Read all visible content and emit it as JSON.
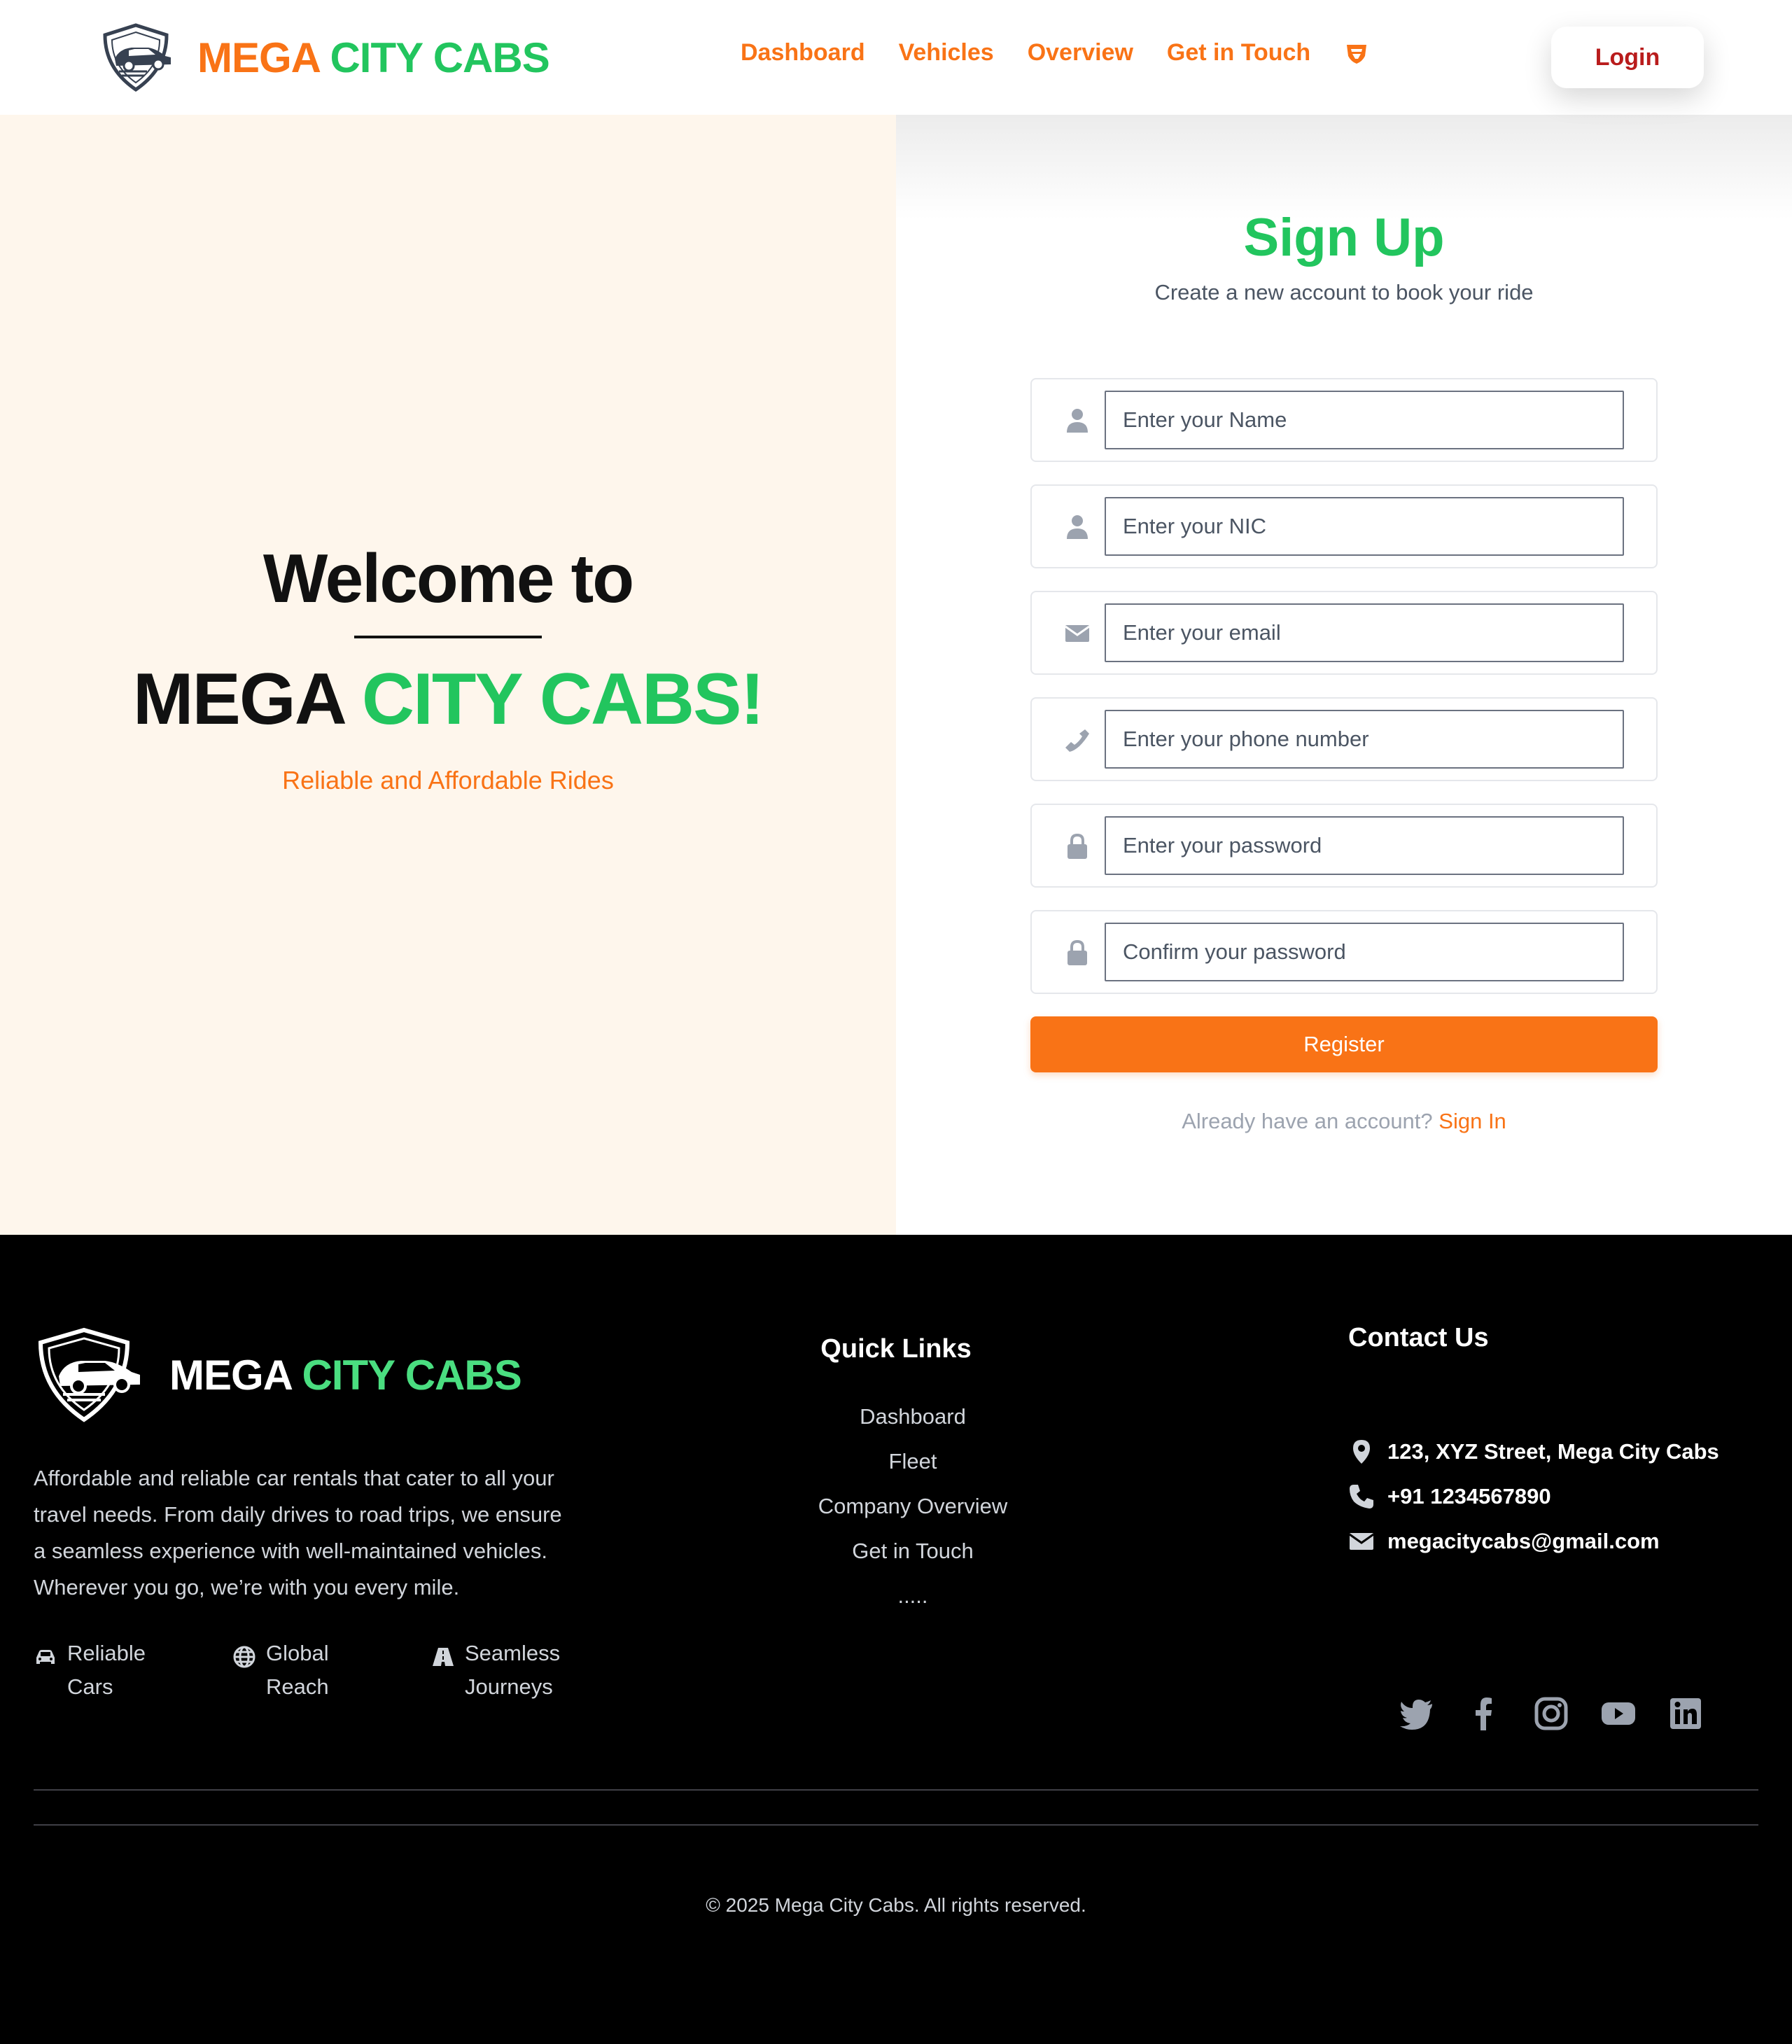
{
  "header": {
    "brand_part1": "MEGA",
    "brand_part2": "CITY CABS",
    "nav": [
      {
        "label": "Dashboard"
      },
      {
        "label": "Vehicles"
      },
      {
        "label": "Overview"
      },
      {
        "label": "Get in Touch"
      }
    ],
    "nav_icon": "shield-icon",
    "login_label": "Login"
  },
  "hero": {
    "welcome": "Welcome to",
    "brand_part1": "MEGA",
    "brand_part2": "CITY CABS!",
    "tagline": "Reliable and Affordable Rides"
  },
  "signup": {
    "title": "Sign Up",
    "subtitle": "Create a new account to book your ride",
    "fields": [
      {
        "icon": "user-icon",
        "placeholder": "Enter your Name",
        "value": ""
      },
      {
        "icon": "user-icon",
        "placeholder": "Enter your NIC",
        "value": ""
      },
      {
        "icon": "envelope-icon",
        "placeholder": "Enter your email",
        "value": ""
      },
      {
        "icon": "phone-icon",
        "placeholder": "Enter your phone number",
        "value": ""
      },
      {
        "icon": "lock-icon",
        "placeholder": "Enter your password",
        "value": ""
      },
      {
        "icon": "lock-icon",
        "placeholder": "Confirm your password",
        "value": ""
      }
    ],
    "register_label": "Register",
    "already_text": "Already have an account?",
    "signin_label": "Sign In"
  },
  "footer": {
    "brand_part1": "MEGA",
    "brand_part2": "CITY CABS",
    "description": "Affordable and reliable car rentals that cater to all your travel needs. From daily drives to road trips, we ensure a seamless experience with well-maintained vehicles. Wherever you go, we’re with you every mile.",
    "features": [
      {
        "icon": "car-icon",
        "label": "Reliable Cars"
      },
      {
        "icon": "globe-icon",
        "label": "Global Reach"
      },
      {
        "icon": "road-icon",
        "label": "Seamless Journeys"
      }
    ],
    "quick_links_title": "Quick Links",
    "quick_links": [
      {
        "label": "Dashboard"
      },
      {
        "label": "Fleet"
      },
      {
        "label": "Company Overview"
      },
      {
        "label": "Get in Touch"
      },
      {
        "label": "....."
      }
    ],
    "contact_title": "Contact Us",
    "contact": [
      {
        "icon": "map-pin-icon",
        "text": "123, XYZ Street, Mega City Cabs"
      },
      {
        "icon": "phone-icon",
        "text": "+91 1234567890"
      },
      {
        "icon": "envelope-icon",
        "text": "megacitycabs@gmail.com"
      }
    ],
    "socials": [
      "twitter-icon",
      "facebook-icon",
      "instagram-icon",
      "youtube-icon",
      "linkedin-icon"
    ],
    "copyright": "© 2025 Mega City Cabs. All rights reserved."
  },
  "colors": {
    "orange": "#f97316",
    "green": "#22c55e",
    "login_red": "#b91c1c",
    "hero_bg": "#fef6ec",
    "footer_bg": "#000000"
  }
}
